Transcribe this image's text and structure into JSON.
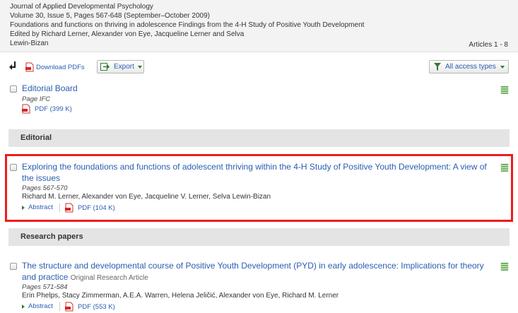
{
  "header": {
    "journal": "Journal of Applied Developmental Psychology",
    "volume": "Volume 30, Issue 5, Pages 567-648 (September–October 2009)",
    "issue_title": "Foundations and functions on thriving in adolescence Findings from the 4-H Study of Positive Youth Development",
    "editors_line1": "Edited by Richard Lerner, Alexander von Eye, Jacqueline Lerner and Selva",
    "editors_line2": "Lewin-Bizan",
    "articles_count": "Articles 1 - 8"
  },
  "toolbar": {
    "download_pdfs_label": "Download PDFs",
    "export_label": "Export",
    "access_label": "All access types"
  },
  "articles": [
    {
      "title": "Editorial Board",
      "pages": "Page IFC",
      "pdf_label": "PDF (399 K)"
    },
    {
      "title": "Exploring the foundations and functions of adolescent thriving within the 4-H Study of Positive Youth Development: A view of the issues",
      "pages": "Pages 567-570",
      "authors": "Richard M. Lerner, Alexander von Eye, Jacqueline V. Lerner, Selva Lewin-Bizan",
      "abstract_label": "Abstract",
      "pdf_label": "PDF (104 K)"
    },
    {
      "title": "The structure and developmental course of Positive Youth Development (PYD) in early adolescence: Implications for theory and practice",
      "type": "Original Research Article",
      "pages": "Pages 571-584",
      "authors": "Erin Phelps, Stacy Zimmerman, A.E.A. Warren, Helena Jeličić, Alexander von Eye, Richard M. Lerner",
      "abstract_label": "Abstract",
      "pdf_label": "PDF (553 K)"
    }
  ],
  "sections": {
    "editorial": "Editorial",
    "research": "Research papers"
  },
  "colors": {
    "link": "#2a5db0",
    "highlight": "#ef1b1b",
    "section_bg": "#e4e4e4",
    "header_bg": "#f3f3f3"
  }
}
